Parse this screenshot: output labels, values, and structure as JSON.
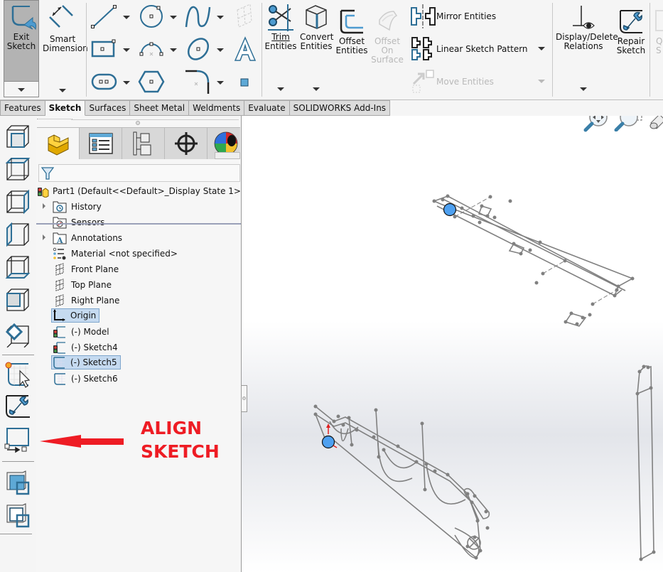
{
  "ribbon": {
    "exit_sketch": "Exit\nSketch",
    "exit_sketch_l1": "Exit",
    "exit_sketch_l2": "Sketch",
    "smart_dimension_l1": "Smart",
    "smart_dimension_l2": "Dimension",
    "trim_l1": "Trim",
    "trim_l2": "Entities",
    "convert_l1": "Convert",
    "convert_l2": "Entities",
    "offset_l1": "Offset",
    "offset_l2": "Entities",
    "offset_surface_l1": "Offset",
    "offset_surface_l2": "On",
    "offset_surface_l3": "Surface",
    "mirror": "Mirror Entities",
    "linear_pattern": "Linear Sketch Pattern",
    "move": "Move Entities",
    "display_delete_l1": "Display/Delete",
    "display_delete_l2": "Relations",
    "repair_l1": "Repair",
    "repair_l2": "Sketch",
    "quick_snaps_l1": "Q",
    "quick_snaps_l2": "S"
  },
  "tabs": [
    {
      "label": "Features",
      "active": false
    },
    {
      "label": "Sketch",
      "active": true
    },
    {
      "label": "Surfaces",
      "active": false
    },
    {
      "label": "Sheet Metal",
      "active": false
    },
    {
      "label": "Weldments",
      "active": false
    },
    {
      "label": "Evaluate",
      "active": false
    },
    {
      "label": "SOLIDWORKS Add-Ins",
      "active": false
    }
  ],
  "feature_tree": {
    "root": "Part1  (Default<<Default>_Display State 1>)",
    "items": [
      {
        "label": "History",
        "icon": "history-folder-icon",
        "expandable": true,
        "selected": false
      },
      {
        "label": "Sensors",
        "icon": "sensors-folder-icon",
        "expandable": false,
        "selected": false
      },
      {
        "label": "Annotations",
        "icon": "annotations-folder-icon",
        "expandable": true,
        "selected": false
      },
      {
        "label": "Material <not specified>",
        "icon": "material-icon",
        "expandable": false,
        "selected": false
      },
      {
        "label": "Front Plane",
        "icon": "plane-icon",
        "expandable": false,
        "selected": false
      },
      {
        "label": "Top Plane",
        "icon": "plane-icon",
        "expandable": false,
        "selected": false
      },
      {
        "label": "Right Plane",
        "icon": "plane-icon",
        "expandable": false,
        "selected": false
      },
      {
        "label": "Origin",
        "icon": "origin-icon",
        "expandable": false,
        "selected": true
      },
      {
        "label": "(-) Model",
        "icon": "sketch-warning-icon",
        "expandable": false,
        "selected": false
      },
      {
        "label": "(-) Sketch4",
        "icon": "sketch-warning-icon",
        "expandable": false,
        "selected": false
      },
      {
        "label": "(-) Sketch5",
        "icon": "sketch-icon",
        "expandable": false,
        "selected": true
      },
      {
        "label": "(-) Sketch6",
        "icon": "sketch-icon",
        "expandable": false,
        "selected": false
      }
    ]
  },
  "annotation": {
    "line1": "ALIGN",
    "line2": "SKETCH",
    "color": "#ee1c24"
  },
  "colors": {
    "accent": "#2e6f96",
    "selection": "#c5daf0",
    "origin_dot": "#4ea0f0",
    "sketch_line": "#808080"
  }
}
